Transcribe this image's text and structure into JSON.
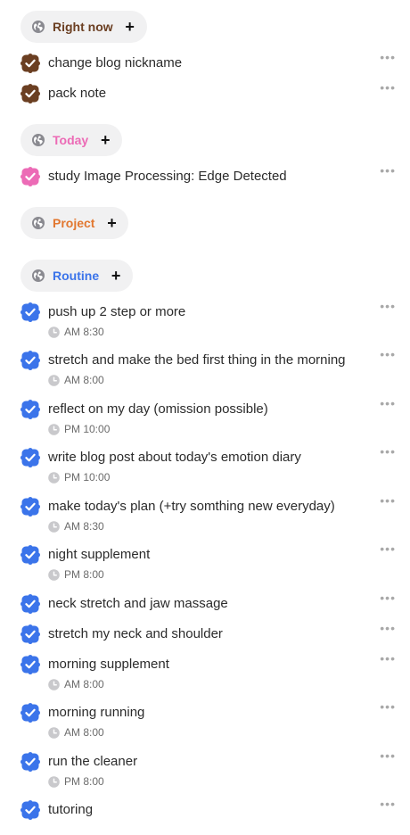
{
  "colors": {
    "brown": "#6b3f22",
    "pink": "#ec6bb6",
    "orange": "#e2772f",
    "blue": "#3b74ea",
    "pill_bg": "#f1f1f2",
    "globe": "#8a8a90",
    "more": "#a8a8a8"
  },
  "sections": {
    "right_now": {
      "label": "Right now",
      "color": "#6b3f22"
    },
    "today": {
      "label": "Today",
      "color": "#ec6bb6"
    },
    "project": {
      "label": "Project",
      "color": "#e2772f"
    },
    "routine": {
      "label": "Routine",
      "color": "#3b74ea"
    }
  },
  "add_symbol": "+",
  "more_symbol": "•••",
  "tasks": {
    "right_now": [
      {
        "title": "change blog nickname"
      },
      {
        "title": "pack note"
      }
    ],
    "today": [
      {
        "title": "study Image Processing: Edge Detected"
      }
    ],
    "routine": [
      {
        "title": "push up 2 step or more",
        "time": "AM 8:30"
      },
      {
        "title": "stretch and make the bed first thing in the morning",
        "time": "AM 8:00"
      },
      {
        "title": "reflect on my day (omission possible)",
        "time": "PM 10:00"
      },
      {
        "title": "write blog post about today's emotion diary",
        "time": "PM 10:00"
      },
      {
        "title": "make today's plan (+try somthing new everyday)",
        "time": "AM 8:30"
      },
      {
        "title": "night supplement",
        "time": "PM 8:00"
      },
      {
        "title": "neck stretch and jaw massage"
      },
      {
        "title": "stretch my neck and shoulder"
      },
      {
        "title": "morning supplement",
        "time": "AM 8:00"
      },
      {
        "title": "morning running",
        "time": "AM 8:00"
      },
      {
        "title": "run the cleaner",
        "time": "PM 8:00"
      },
      {
        "title": "tutoring"
      }
    ]
  }
}
